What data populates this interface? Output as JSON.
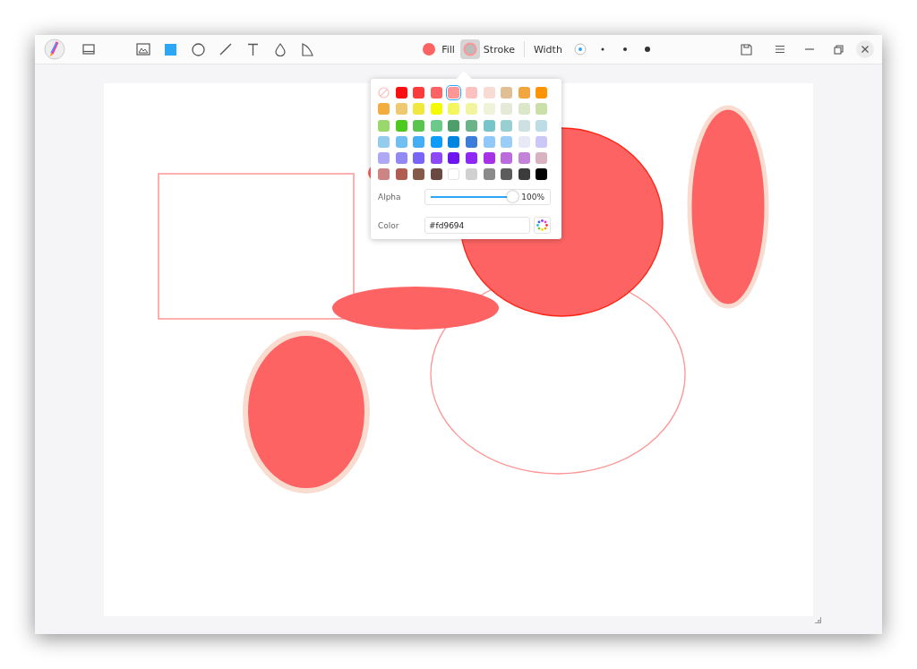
{
  "toolbar": {
    "tools": [
      {
        "kind": "image",
        "selected": false
      },
      {
        "kind": "rectangle",
        "selected": true
      },
      {
        "kind": "ellipse",
        "selected": false
      },
      {
        "kind": "line",
        "selected": false
      },
      {
        "kind": "text",
        "selected": false
      },
      {
        "kind": "blur",
        "selected": false
      },
      {
        "kind": "polygon",
        "selected": false
      }
    ],
    "fill": {
      "label": "Fill",
      "color": "#fd6363"
    },
    "stroke": {
      "label": "Stroke",
      "color": "#fd9694",
      "selected": true
    },
    "width": {
      "label": "Width",
      "options": [
        {
          "selected": true
        },
        {
          "selected": false
        },
        {
          "selected": false
        },
        {
          "selected": false
        }
      ]
    }
  },
  "color_picker": {
    "swatches": [
      {
        "kind": "none",
        "selected": false
      },
      {
        "kind": "color",
        "color": "#fe0e0e",
        "selected": false
      },
      {
        "kind": "color",
        "color": "#fd3b3b",
        "selected": false
      },
      {
        "kind": "color",
        "color": "#fd6363",
        "selected": false
      },
      {
        "kind": "color",
        "color": "#fd9694",
        "selected": true
      },
      {
        "kind": "color",
        "color": "#fdc2c0",
        "selected": false
      },
      {
        "kind": "color",
        "color": "#f8dcd4",
        "selected": false
      },
      {
        "kind": "color",
        "color": "#e1bf94",
        "selected": false
      },
      {
        "kind": "color",
        "color": "#f2a640",
        "selected": false
      },
      {
        "kind": "color",
        "color": "#fe9400",
        "selected": false
      },
      {
        "kind": "color",
        "color": "#f2ad3e",
        "selected": false
      },
      {
        "kind": "color",
        "color": "#eec96f",
        "selected": false
      },
      {
        "kind": "color",
        "color": "#f1e83f",
        "selected": false
      },
      {
        "kind": "color",
        "color": "#f4fb00",
        "selected": false
      },
      {
        "kind": "color",
        "color": "#f4f660",
        "selected": false
      },
      {
        "kind": "color",
        "color": "#f3f4a0",
        "selected": false
      },
      {
        "kind": "color",
        "color": "#eff3d9",
        "selected": false
      },
      {
        "kind": "color",
        "color": "#e4e9d8",
        "selected": false
      },
      {
        "kind": "color",
        "color": "#dce6c8",
        "selected": false
      },
      {
        "kind": "color",
        "color": "#cbdfa9",
        "selected": false
      },
      {
        "kind": "color",
        "color": "#9bd86c",
        "selected": false
      },
      {
        "kind": "color",
        "color": "#4ec91d",
        "selected": false
      },
      {
        "kind": "color",
        "color": "#5ac44f",
        "selected": false
      },
      {
        "kind": "color",
        "color": "#6bc98a",
        "selected": false
      },
      {
        "kind": "color",
        "color": "#4d9e68",
        "selected": false
      },
      {
        "kind": "color",
        "color": "#6bb48a",
        "selected": false
      },
      {
        "kind": "color",
        "color": "#77c5cb",
        "selected": false
      },
      {
        "kind": "color",
        "color": "#97cfd3",
        "selected": false
      },
      {
        "kind": "color",
        "color": "#cde1e2",
        "selected": false
      },
      {
        "kind": "color",
        "color": "#bcdde6",
        "selected": false
      },
      {
        "kind": "color",
        "color": "#94ccec",
        "selected": false
      },
      {
        "kind": "color",
        "color": "#70bff0",
        "selected": false
      },
      {
        "kind": "color",
        "color": "#43aef4",
        "selected": false
      },
      {
        "kind": "color",
        "color": "#0f9dfc",
        "selected": false
      },
      {
        "kind": "color",
        "color": "#0086e1",
        "selected": false
      },
      {
        "kind": "color",
        "color": "#3b7dd9",
        "selected": false
      },
      {
        "kind": "color",
        "color": "#8fc8f9",
        "selected": false
      },
      {
        "kind": "color",
        "color": "#9acdf7",
        "selected": false
      },
      {
        "kind": "color",
        "color": "#e7e9f7",
        "selected": false
      },
      {
        "kind": "color",
        "color": "#cbc8f7",
        "selected": false
      },
      {
        "kind": "color",
        "color": "#aea8f5",
        "selected": false
      },
      {
        "kind": "color",
        "color": "#9389f5",
        "selected": false
      },
      {
        "kind": "color",
        "color": "#7865f7",
        "selected": false
      },
      {
        "kind": "color",
        "color": "#8b49f7",
        "selected": false
      },
      {
        "kind": "color",
        "color": "#6c15ee",
        "selected": false
      },
      {
        "kind": "color",
        "color": "#8f27f7",
        "selected": false
      },
      {
        "kind": "color",
        "color": "#a631e5",
        "selected": false
      },
      {
        "kind": "color",
        "color": "#bd6ade",
        "selected": false
      },
      {
        "kind": "color",
        "color": "#c383d8",
        "selected": false
      },
      {
        "kind": "color",
        "color": "#d8b2c0",
        "selected": false
      },
      {
        "kind": "color",
        "color": "#cc8484",
        "selected": false
      },
      {
        "kind": "color",
        "color": "#b15d51",
        "selected": false
      },
      {
        "kind": "color",
        "color": "#855a4a",
        "selected": false
      },
      {
        "kind": "color",
        "color": "#684a43",
        "selected": false
      },
      {
        "kind": "color",
        "color": "#ffffff",
        "selected": false
      },
      {
        "kind": "color",
        "color": "#d0d0d0",
        "selected": false
      },
      {
        "kind": "color",
        "color": "#8a8a8a",
        "selected": false
      },
      {
        "kind": "color",
        "color": "#5c5c5c",
        "selected": false
      },
      {
        "kind": "color",
        "color": "#3c3c3c",
        "selected": false
      },
      {
        "kind": "color",
        "color": "#000000",
        "selected": false
      }
    ],
    "alpha": {
      "label": "Alpha",
      "level": 1,
      "reading": "100%"
    },
    "color": {
      "label": "Color",
      "value": "#fd9694"
    }
  }
}
